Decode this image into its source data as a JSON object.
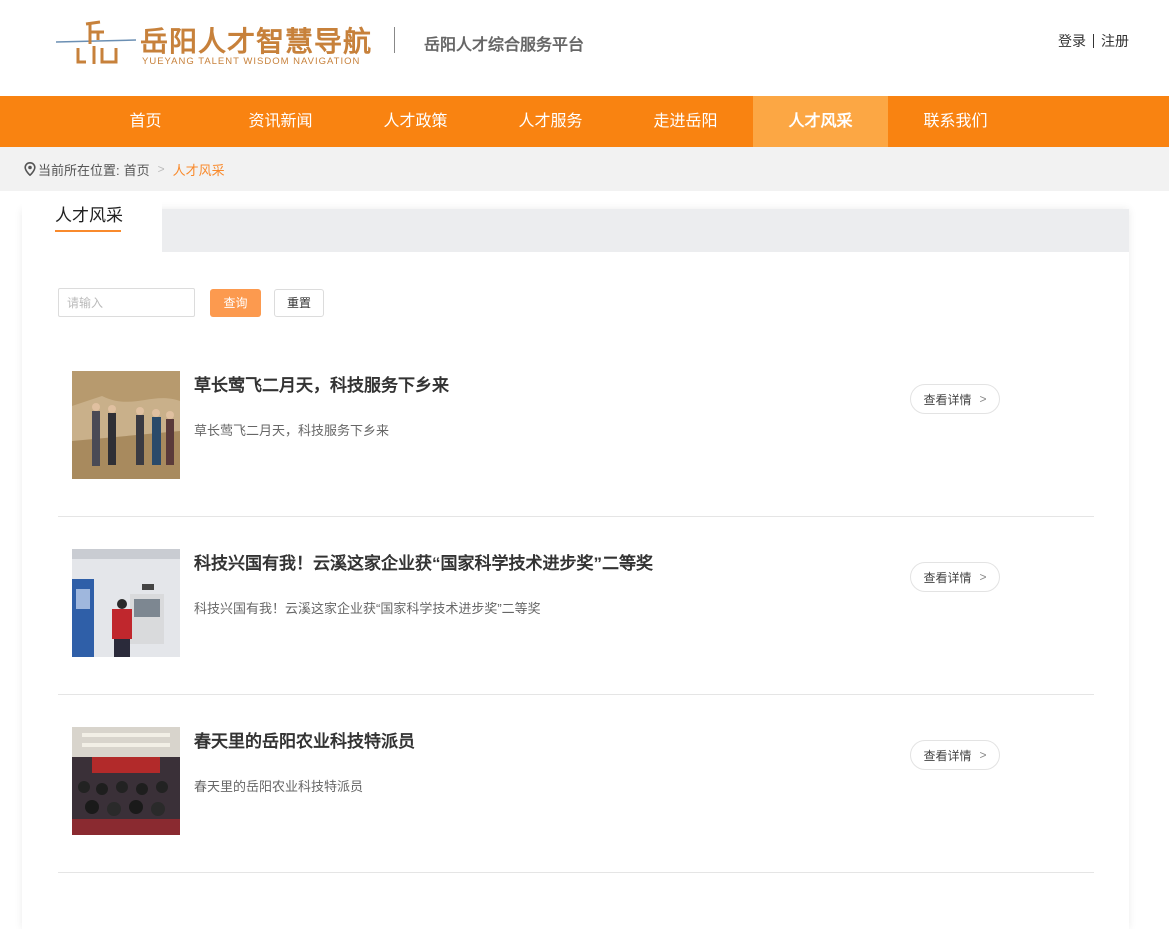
{
  "header": {
    "logo_cn": "岳阳人才智慧导航",
    "logo_en": "YUEYANG TALENT WISDOM NAVIGATION",
    "subtitle": "岳阳人才综合服务平台",
    "login": "登录",
    "register": "注册"
  },
  "nav": {
    "items": [
      {
        "label": "首页"
      },
      {
        "label": "资讯新闻"
      },
      {
        "label": "人才政策"
      },
      {
        "label": "人才服务"
      },
      {
        "label": "走进岳阳"
      },
      {
        "label": "人才风采"
      },
      {
        "label": "联系我们"
      }
    ],
    "active_index": 5
  },
  "breadcrumb": {
    "prefix": "当前所在位置:",
    "home": "首页",
    "current": "人才风采"
  },
  "tab": {
    "label": "人才风采"
  },
  "search": {
    "placeholder": "请输入",
    "value": "",
    "query_label": "查询",
    "reset_label": "重置"
  },
  "list": {
    "detail_label": "查看详情",
    "items": [
      {
        "title": "草长莺飞二月天，科技服务下乡来",
        "desc": "草长莺飞二月天，科技服务下乡来"
      },
      {
        "title": "科技兴国有我！云溪这家企业获“国家科学技术进步奖”二等奖",
        "desc": "科技兴国有我！云溪这家企业获“国家科学技术进步奖”二等奖"
      },
      {
        "title": "春天里的岳阳农业科技特派员",
        "desc": "春天里的岳阳农业科技特派员"
      }
    ]
  },
  "colors": {
    "nav_bg": "#f98311",
    "nav_active": "#fca744",
    "accent": "#f98a2c",
    "logo": "#c7813b"
  }
}
